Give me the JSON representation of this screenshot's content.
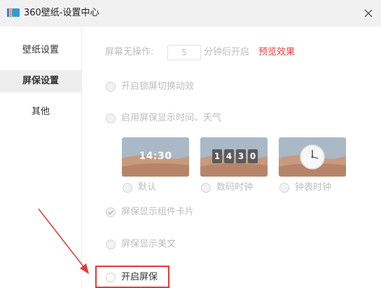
{
  "window": {
    "title": "360壁纸-设置中心",
    "logo_icon": "360-wallpaper-logo",
    "close_icon": "close-icon"
  },
  "sidebar": {
    "items": [
      {
        "label": "壁纸设置",
        "active": false
      },
      {
        "label": "屏保设置",
        "active": true
      },
      {
        "label": "其他",
        "active": false
      }
    ]
  },
  "settings": {
    "idle_prefix": "屏幕无操作:",
    "idle_minutes": "5",
    "idle_suffix": "分钟后开启",
    "preview_link": "预览效果",
    "lock_anim_label": "开启锁屏切换动效",
    "show_time_weather_label": "启用屏保显示时间、天气",
    "clock_styles": [
      {
        "label": "默认",
        "sample": "14:30"
      },
      {
        "label": "数码时钟",
        "digits": [
          "1",
          "4",
          "3",
          "0"
        ]
      },
      {
        "label": "钟表时钟"
      }
    ],
    "show_widgets_label": "屏保显示组件卡片",
    "show_widgets_checked": true,
    "show_quotes_label": "屏保显示美文",
    "enable_screensaver_label": "开启屏保"
  },
  "colors": {
    "accent_red": "#f04040",
    "annotation_red": "#e53935",
    "disabled_text": "#bdbdbd"
  }
}
